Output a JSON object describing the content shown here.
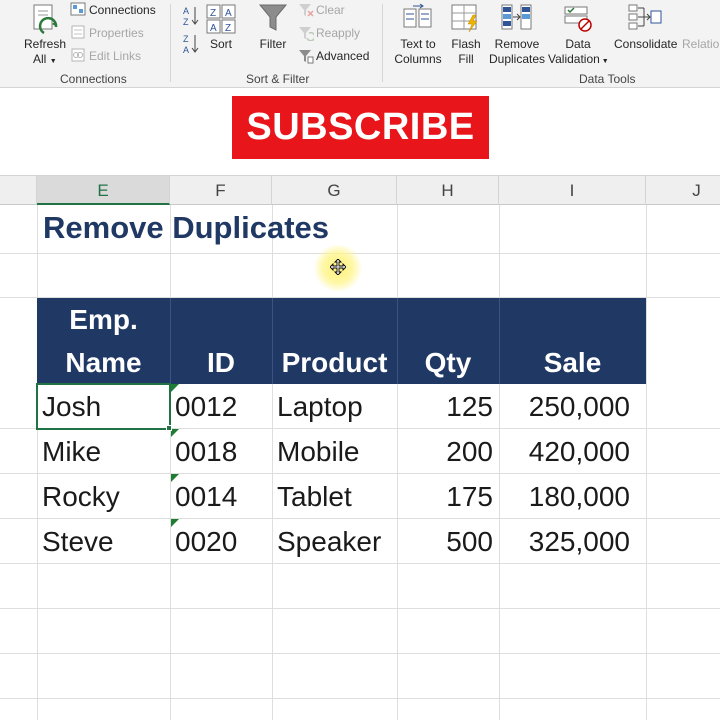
{
  "ribbon": {
    "connections_group": {
      "refresh_label": "Refresh",
      "refresh_sub": "All",
      "connections": "Connections",
      "properties": "Properties",
      "edit_links": "Edit Links",
      "group_label": "Connections"
    },
    "sort_filter_group": {
      "sort": "Sort",
      "filter": "Filter",
      "clear": "Clear",
      "reapply": "Reapply",
      "advanced": "Advanced",
      "group_label": "Sort & Filter"
    },
    "data_tools_group": {
      "text_to_columns_1": "Text to",
      "text_to_columns_2": "Columns",
      "flash_fill_1": "Flash",
      "flash_fill_2": "Fill",
      "remove_duplicates_1": "Remove",
      "remove_duplicates_2": "Duplicates",
      "data_validation_1": "Data",
      "data_validation_2": "Validation",
      "consolidate": "Consolidate",
      "relationships": "Relation",
      "group_label": "Data Tools"
    }
  },
  "overlay": {
    "subscribe": "SUBSCRIBE"
  },
  "columns": [
    "E",
    "F",
    "G",
    "H",
    "I",
    "J"
  ],
  "sheet": {
    "title": "Remove Duplicates",
    "headers": {
      "name_line1": "Emp.",
      "name_line2": "Name",
      "id": "ID",
      "product": "Product",
      "qty": "Qty",
      "sale": "Sale"
    },
    "rows": [
      {
        "name": "Josh",
        "id": "0012",
        "product": "Laptop",
        "qty": "125",
        "sale": "250,000"
      },
      {
        "name": "Mike",
        "id": "0018",
        "product": "Mobile",
        "qty": "200",
        "sale": "420,000"
      },
      {
        "name": "Rocky",
        "id": "0014",
        "product": "Tablet",
        "qty": "175",
        "sale": "180,000"
      },
      {
        "name": "Steve",
        "id": "0020",
        "product": "Speaker",
        "qty": "500",
        "sale": "325,000"
      }
    ]
  },
  "colors": {
    "header_fill": "#203864",
    "title": "#203864",
    "accent": "#217346",
    "subscribe_bg": "#e8151b"
  }
}
